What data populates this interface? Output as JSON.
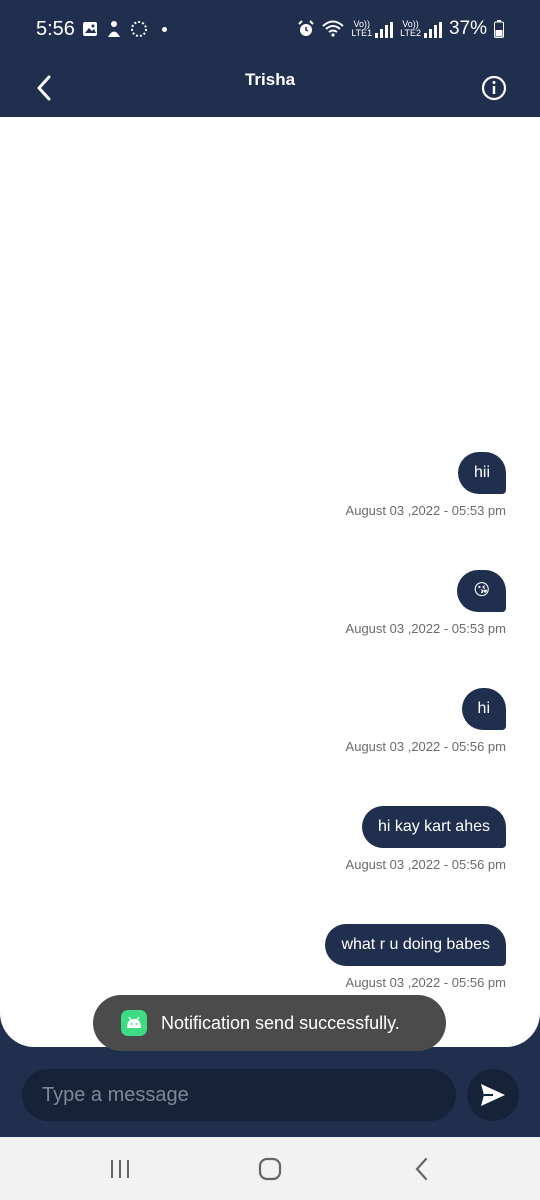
{
  "status_bar": {
    "time": "5:56",
    "battery": "37%",
    "sim1_top": "Vo))",
    "sim1_bottom": "LTE1",
    "sim2_top": "Vo))",
    "sim2_bottom": "LTE2"
  },
  "header": {
    "title": "Trisha"
  },
  "messages": [
    {
      "text": "hii",
      "time": "August 03 ,2022 - 05:53 pm"
    },
    {
      "text": "😘",
      "time": "August 03 ,2022 - 05:53 pm"
    },
    {
      "text": "hi",
      "time": "August 03 ,2022 - 05:56 pm"
    },
    {
      "text": "hi kay kart ahes",
      "time": "August 03 ,2022 - 05:56 pm"
    },
    {
      "text": "what r u doing babes",
      "time": "August 03 ,2022 - 05:56 pm"
    }
  ],
  "toast": {
    "text": "Notification send successfully."
  },
  "composer": {
    "placeholder": "Type a message"
  },
  "colors": {
    "primary": "#1f2f4d",
    "input_bg": "#152238",
    "toast_bg": "#4b4b4b",
    "android_green": "#3ddc84"
  }
}
